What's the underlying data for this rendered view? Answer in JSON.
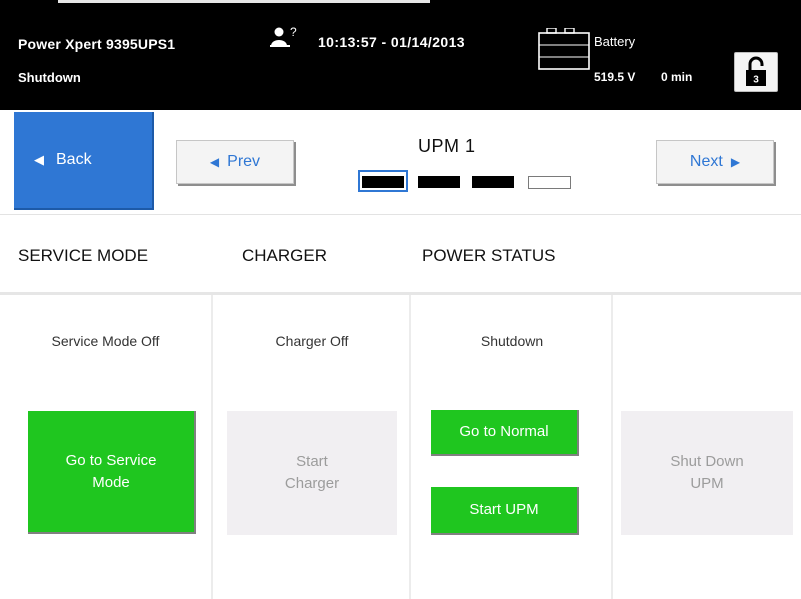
{
  "header": {
    "unit_name": "Power Xpert 9395UPS1",
    "status": "Shutdown",
    "alarm_icon": "alarm-person-icon",
    "alarm_badge": "?",
    "datetime": "10:13:57 - 01/14/2013",
    "battery": {
      "label": "Battery",
      "voltage": "519.5 V",
      "time": "0 min"
    },
    "lock_badge": "3"
  },
  "nav": {
    "back_label": "Back",
    "prev_label": "Prev",
    "next_label": "Next",
    "title": "UPM 1",
    "pages": [
      {
        "filled": true,
        "selected": true
      },
      {
        "filled": true,
        "selected": false
      },
      {
        "filled": true,
        "selected": false
      },
      {
        "filled": false,
        "selected": false
      }
    ]
  },
  "tabs": [
    {
      "label": "SERVICE MODE"
    },
    {
      "label": "CHARGER"
    },
    {
      "label": "POWER STATUS"
    }
  ],
  "panels": {
    "service": {
      "status": "Service Mode Off",
      "button": "Go to Service\nMode"
    },
    "charger": {
      "status": "Charger Off",
      "button": "Start\nCharger"
    },
    "power": {
      "status": "Shutdown",
      "normal_button": "Go to Normal",
      "start_button": "Start UPM"
    },
    "upm": {
      "button": "Shut Down\nUPM"
    }
  },
  "colors": {
    "accent_blue": "#2f77d4",
    "active_green": "#1fc61f",
    "disabled_bg": "#f1eff2",
    "header_bg": "#000000"
  }
}
